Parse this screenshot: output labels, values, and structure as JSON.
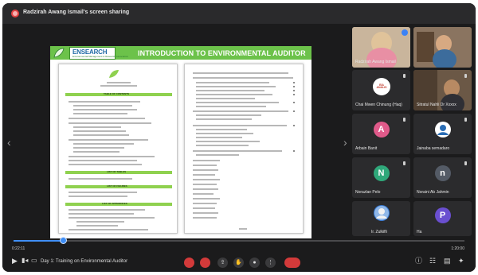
{
  "window": {
    "title": "Radzirah Awang Ismail's screen sharing",
    "accent": "#6cc24a"
  },
  "slide": {
    "logo_text": "ENSEARCH",
    "logo_sub": "Environmental Management & Research Association",
    "title": "INTRODUCTION TO ENVIRONMENTAL AUDITOR",
    "left_page_heading": "TABLE OF CONTENTS",
    "left_page_sections": [
      "LIST OF TABLES",
      "LIST OF FIGURES",
      "LIST OF APPENDICES"
    ]
  },
  "participants": [
    {
      "name": "Radzirah Awang Ismail",
      "type": "video",
      "speaking": true
    },
    {
      "name": "",
      "type": "video"
    },
    {
      "name": "Chai Mwen Chinung (Haq)",
      "type": "logo",
      "logo": "EIA ANALIS"
    },
    {
      "name": "Sitratul Nahli Dr Xxxxx",
      "type": "video"
    },
    {
      "name": "Arbain Banit",
      "type": "avatar",
      "letter": "A",
      "color": "#e05a8a"
    },
    {
      "name": "Jainaba semadaro",
      "type": "avatar",
      "letter": "",
      "color": "#ffffff"
    },
    {
      "name": "Norazlan Pelo",
      "type": "avatar",
      "letter": "N",
      "color": "#2fa87a"
    },
    {
      "name": "Noraini Ab Jahmin",
      "type": "avatar",
      "letter": "n",
      "color": "#545b66"
    },
    {
      "name": "Ir. Zulkifli",
      "type": "avatar",
      "letter": "",
      "color": "#3a7bd5"
    },
    {
      "name": "Ha",
      "type": "avatar",
      "letter": "P",
      "color": "#6a4fd0"
    }
  ],
  "playback": {
    "elapsed": "0:22:11",
    "total": "1:20:00",
    "progress_percent": 11
  },
  "controls": {
    "meeting_label": "Day 1: Training on Environmental Auditor"
  }
}
